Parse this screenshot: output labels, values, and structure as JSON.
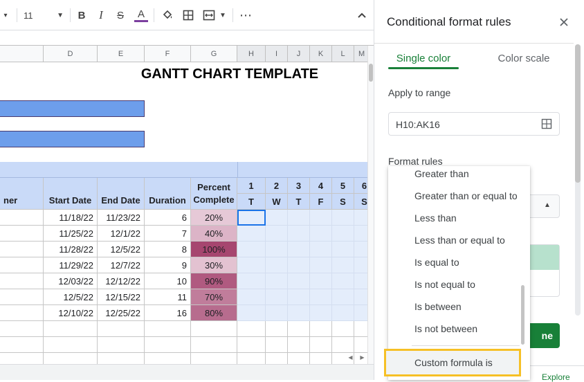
{
  "toolbar": {
    "font_size": "11",
    "bold": "B",
    "italic": "I",
    "strike": "S",
    "text_color": "A",
    "more": "⋯",
    "collapse": "⌃"
  },
  "columns": {
    "letters": [
      "D",
      "E",
      "F",
      "G",
      "H",
      "I",
      "J",
      "K",
      "L",
      "M"
    ]
  },
  "sheet": {
    "title": "GANTT CHART TEMPLATE",
    "headers": {
      "owner": "ner",
      "start_date": "Start Date",
      "end_date": "End Date",
      "duration": "Duration",
      "percent_line1": "Percent",
      "percent_line2": "Complete"
    },
    "day_numbers": [
      "1",
      "2",
      "3",
      "4",
      "5",
      "6"
    ],
    "day_letters": [
      "T",
      "W",
      "T",
      "F",
      "S",
      "S"
    ],
    "rows": [
      {
        "start": "11/18/22",
        "end": "11/23/22",
        "duration": "6",
        "percent": "20%",
        "color": "#e6c9d7"
      },
      {
        "start": "11/25/22",
        "end": "12/1/22",
        "duration": "7",
        "percent": "40%",
        "color": "#dcb4c7"
      },
      {
        "start": "11/28/22",
        "end": "12/5/22",
        "duration": "8",
        "percent": "100%",
        "color": "#a6466f"
      },
      {
        "start": "11/29/22",
        "end": "12/7/22",
        "duration": "9",
        "percent": "30%",
        "color": "#e3c2d1"
      },
      {
        "start": "12/03/22",
        "end": "12/12/22",
        "duration": "10",
        "percent": "90%",
        "color": "#b05a80"
      },
      {
        "start": "12/5/22",
        "end": "12/15/22",
        "duration": "11",
        "percent": "70%",
        "color": "#c07d9b"
      },
      {
        "start": "12/10/22",
        "end": "12/25/22",
        "duration": "16",
        "percent": "80%",
        "color": "#b76c8e"
      }
    ]
  },
  "panel": {
    "title": "Conditional format rules",
    "tabs": {
      "single": "Single color",
      "scale": "Color scale"
    },
    "apply_label": "Apply to range",
    "range_value": "H10:AK16",
    "format_rules_label": "Format rules",
    "done_fragment": "ne",
    "explore": "Explore"
  },
  "menu": {
    "items": [
      "Greater than",
      "Greater than or equal to",
      "Less than",
      "Less than or equal to",
      "Is equal to",
      "Is not equal to",
      "Is between",
      "Is not between"
    ],
    "custom": "Custom formula is"
  },
  "colors": {
    "accent_green": "#188038",
    "bar_blue": "#6d9eeb",
    "header_blue": "#c9daf8",
    "highlight_yellow": "#f6c026"
  }
}
